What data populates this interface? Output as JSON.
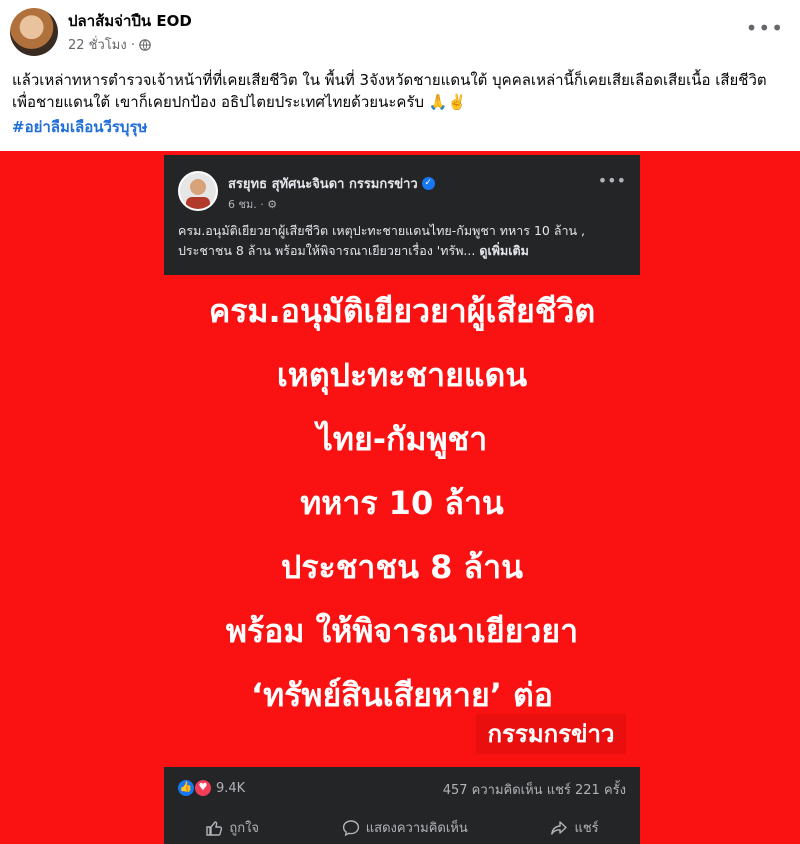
{
  "post": {
    "author": "ปลาส้มจ่าปืน EOD",
    "time": "22 ชั่วโมง ·",
    "more_icon": "more-horizontal-icon",
    "text": "แล้วเหล่าทหารตำรวจเจ้าหน้าที่ที่เคยเสียชีวิต ใน พื้นที่ 3จังหวัดชายแดนใต้ บุคคลเหล่านี้ก็เคยเสียเลือดเสียเนื้อ เสียชีวิต เพื่อชายแดนใต้ เขาก็เคยปกป้อง อธิปไตยประเทศไทยด้วยนะครับ 🙏✌️",
    "hashtag": "#อย่าลืมเลือนวีรบุรุษ"
  },
  "shared": {
    "author": "สรยุทธ สุทัศนะจินดา กรรมกรข่าว",
    "time": "6 ชม. ·",
    "text": "ครม.อนุมัติเยียวยาผู้เสียชีวิต เหตุปะทะชายแดนไทย-กัมพูชา ทหาร 10 ล้าน , ประชาชน 8 ล้าน พร้อมให้พิจารณาเยียวยาเรื่อง 'ทรัพ...",
    "see_more": "ดูเพิ่มเติม",
    "headline": [
      "ครม.อนุมัติเยียวยาผู้เสียชีวิต",
      "เหตุปะทะชายแดน",
      "ไทย-กัมพูชา",
      "ทหาร 10 ล้าน",
      "ประชาชน 8 ล้าน",
      "พร้อม ให้พิจารณาเยียวยา",
      "‘ทรัพย์สินเสียหาย’ ต่อ"
    ],
    "news_tag": "กรรมกรข่าว",
    "reactions_count": "9.4K",
    "stats": "457 ความคิดเห็น  แชร์ 221 ครั้ง",
    "actions": {
      "like": "ถูกใจ",
      "comment": "แสดงความคิดเห็น",
      "share": "แชร์"
    }
  },
  "colors": {
    "banner_red": "#fa1111",
    "dark_card": "#242526",
    "link_blue": "#216fdb"
  }
}
